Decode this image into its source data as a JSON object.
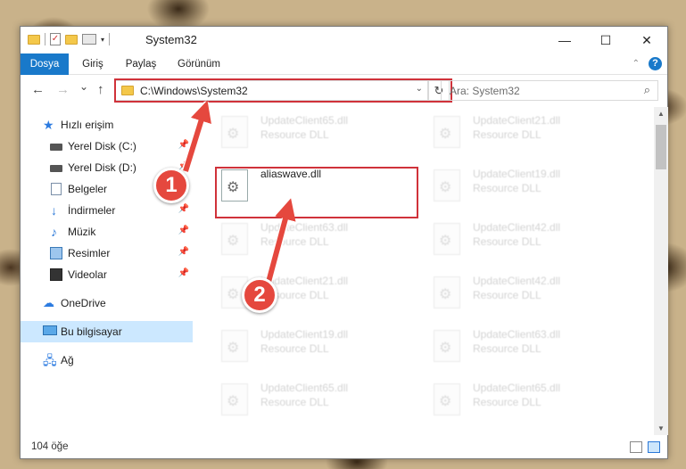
{
  "window": {
    "title": "System32",
    "controls": {
      "minimize": "—",
      "maximize": "☐",
      "close": "✕"
    }
  },
  "ribbon": {
    "tabs": [
      {
        "label": "Dosya",
        "active": true
      },
      {
        "label": "Giriş",
        "active": false
      },
      {
        "label": "Paylaş",
        "active": false
      },
      {
        "label": "Görünüm",
        "active": false
      }
    ],
    "help": "?"
  },
  "nav": {
    "back": "←",
    "forward": "→",
    "recent": "⌄",
    "up": "↑",
    "address": "C:\\Windows\\System32",
    "refresh": "↻",
    "search_placeholder": "Ara: System32"
  },
  "sidebar": {
    "items": [
      {
        "label": "Hızlı erişim",
        "icon": "star-icon",
        "pinned": false
      },
      {
        "label": "Yerel Disk (C:)",
        "icon": "drive-icon",
        "pinned": true
      },
      {
        "label": "Yerel Disk (D:)",
        "icon": "drive-icon",
        "pinned": true
      },
      {
        "label": "Belgeler",
        "icon": "documents-icon",
        "pinned": true
      },
      {
        "label": "İndirmeler",
        "icon": "downloads-icon",
        "pinned": true
      },
      {
        "label": "Müzik",
        "icon": "music-icon",
        "pinned": true
      },
      {
        "label": "Resimler",
        "icon": "pictures-icon",
        "pinned": true
      },
      {
        "label": "Videolar",
        "icon": "videos-icon",
        "pinned": true
      },
      {
        "label": "OneDrive",
        "icon": "cloud-icon",
        "pinned": false
      },
      {
        "label": "Bu bilgisayar",
        "icon": "computer-icon",
        "pinned": false,
        "selected": true
      },
      {
        "label": "Ağ",
        "icon": "network-icon",
        "pinned": false
      }
    ]
  },
  "files": {
    "left_column": [
      {
        "name": "UpdateClient65.dll",
        "type": "Resource DLL",
        "faded": true
      },
      {
        "name": "aliaswave.dll",
        "type": "",
        "faded": false,
        "selected": true
      },
      {
        "name": "UpdateClient63.dll",
        "type": "Resource DLL",
        "faded": true
      },
      {
        "name": "UpdateClient21.dll",
        "type": "Resource DLL",
        "faded": true
      },
      {
        "name": "UpdateClient19.dll",
        "type": "Resource DLL",
        "faded": true
      },
      {
        "name": "UpdateClient65.dll",
        "type": "Resource DLL",
        "faded": true
      }
    ],
    "right_column": [
      {
        "name": "UpdateClient21.dll",
        "type": "Resource DLL",
        "faded": true
      },
      {
        "name": "UpdateClient19.dll",
        "type": "Resource DLL",
        "faded": true
      },
      {
        "name": "UpdateClient42.dll",
        "type": "Resource DLL",
        "faded": true
      },
      {
        "name": "UpdateClient42.dll",
        "type": "Resource DLL",
        "faded": true
      },
      {
        "name": "UpdateClient63.dll",
        "type": "Resource DLL",
        "faded": true
      },
      {
        "name": "UpdateClient65.dll",
        "type": "Resource DLL",
        "faded": true
      }
    ]
  },
  "status": {
    "item_count": "104 öğe"
  },
  "annotations": {
    "step1": "1",
    "step2": "2",
    "highlight_color": "#d0323a",
    "marker_color": "#e5483e"
  },
  "colors": {
    "accent": "#1979ca",
    "selection": "#cce8ff"
  }
}
